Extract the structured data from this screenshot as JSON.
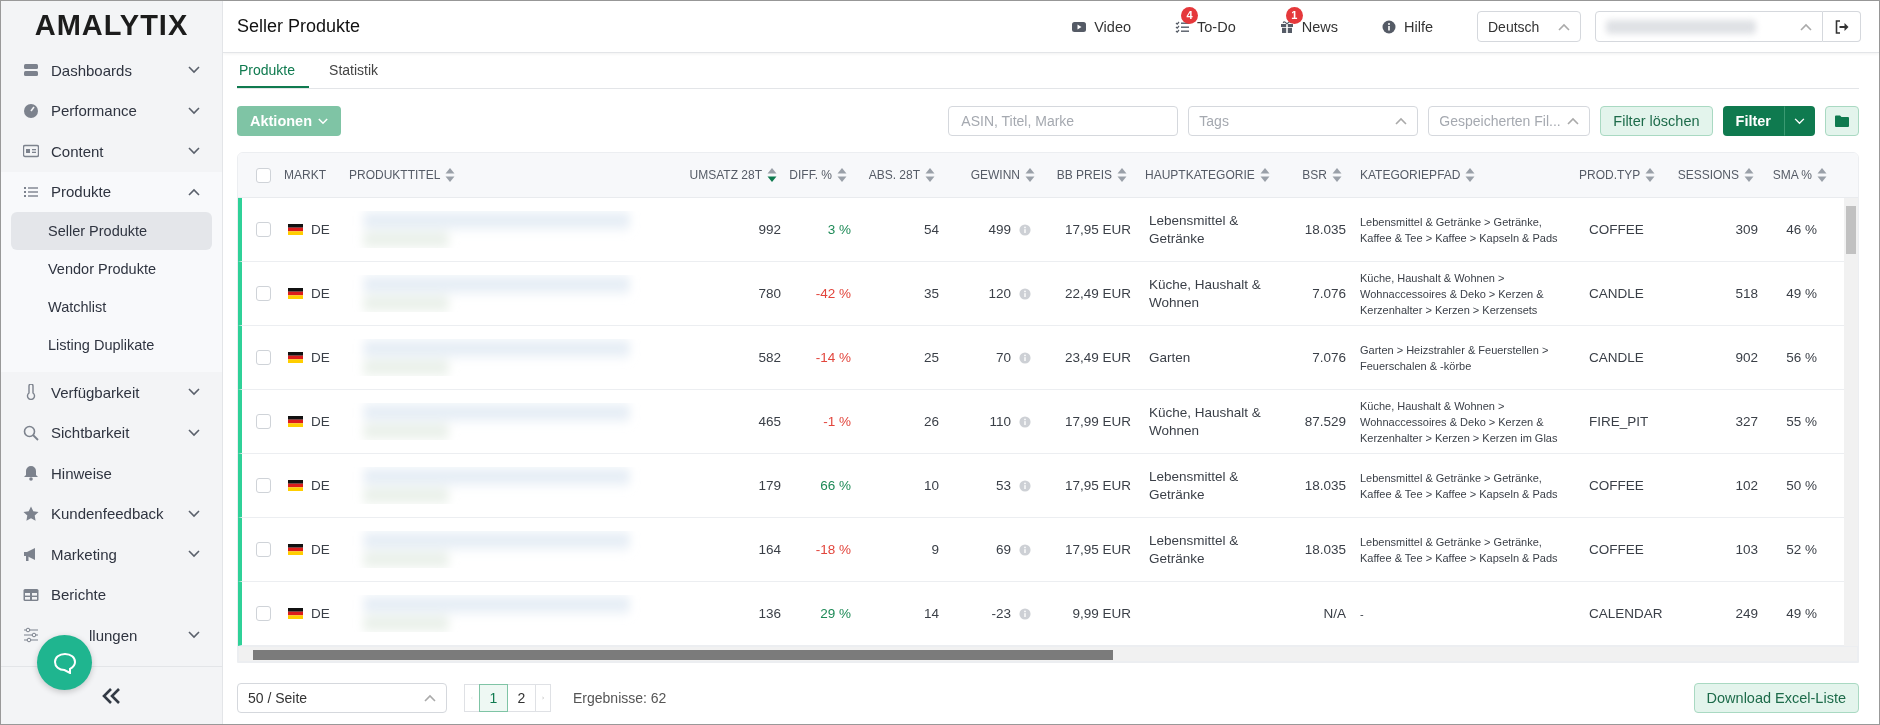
{
  "sidebar": {
    "logo": "AMALYTIX",
    "items": [
      {
        "label": "Dashboards",
        "expanded": false
      },
      {
        "label": "Performance",
        "expanded": false
      },
      {
        "label": "Content",
        "expanded": false
      },
      {
        "label": "Produkte",
        "expanded": true,
        "children": [
          {
            "label": "Seller Produkte",
            "selected": true
          },
          {
            "label": "Vendor Produkte",
            "selected": false
          },
          {
            "label": "Watchlist",
            "selected": false
          },
          {
            "label": "Listing Duplikate",
            "selected": false
          }
        ]
      },
      {
        "label": "Verfügbarkeit",
        "expanded": false
      },
      {
        "label": "Sichtbarkeit",
        "expanded": false
      },
      {
        "label": "Hinweise"
      },
      {
        "label": "Kundenfeedback",
        "expanded": false
      },
      {
        "label": "Marketing",
        "expanded": false
      },
      {
        "label": "Berichte"
      },
      {
        "label": "llungen",
        "expanded": false,
        "covered": true
      }
    ]
  },
  "header": {
    "title": "Seller Produkte",
    "links": [
      {
        "label": "Video"
      },
      {
        "label": "To-Do",
        "badge": "4"
      },
      {
        "label": "News",
        "badge": "1"
      },
      {
        "label": "Hilfe"
      }
    ],
    "language": "Deutsch"
  },
  "tabs": [
    {
      "label": "Produkte",
      "selected": true
    },
    {
      "label": "Statistik",
      "selected": false
    }
  ],
  "toolbar": {
    "actions": "Aktionen",
    "search_placeholder": "ASIN, Titel, Marke",
    "tags_placeholder": "Tags",
    "saved_placeholder": "Gespeicherten Fil...",
    "clear": "Filter löschen",
    "filter": "Filter"
  },
  "table": {
    "columns": [
      {
        "label": "MARKT"
      },
      {
        "label": "PRODUKTTITEL",
        "sorted": false
      },
      {
        "label": "UMSATZ 28T",
        "sorted": true
      },
      {
        "label": "DIFF. %",
        "sorted": false
      },
      {
        "label": "ABS. 28T",
        "sorted": false
      },
      {
        "label": "GEWINN",
        "sorted": false
      },
      {
        "label": "BB PREIS",
        "sorted": false
      },
      {
        "label": "HAUPTKATEGORIE",
        "sorted": false
      },
      {
        "label": "BSR",
        "sorted": false
      },
      {
        "label": "KATEGORIEPFAD",
        "sorted": false
      },
      {
        "label": "PROD.TYP",
        "sorted": false
      },
      {
        "label": "SESSIONS",
        "sorted": false
      },
      {
        "label": "SMA %",
        "sorted": false
      }
    ],
    "select_all_checked": false,
    "rows": [
      {
        "checked": false,
        "market": "DE",
        "umsatz": "992",
        "diff": "3 %",
        "positive": true,
        "abs": "54",
        "gewinn": "499",
        "bb_preis": "17,95 EUR",
        "hauptkategorie": "Lebensmittel & Getränke",
        "bsr": "18.035",
        "kategoriepfad": "Lebensmittel & Getränke > Getränke, Kaffee & Tee > Kaffee > Kapseln & Pads",
        "prod_typ": "COFFEE",
        "sessions": "309",
        "sma": "46 %"
      },
      {
        "checked": false,
        "market": "DE",
        "umsatz": "780",
        "diff": "-42 %",
        "positive": false,
        "abs": "35",
        "gewinn": "120",
        "bb_preis": "22,49 EUR",
        "hauptkategorie": "Küche, Haushalt & Wohnen",
        "bsr": "7.076",
        "kategoriepfad": "Küche, Haushalt & Wohnen > Wohnaccessoires & Deko > Kerzen & Kerzenhalter > Kerzen > Kerzensets",
        "prod_typ": "CANDLE",
        "sessions": "518",
        "sma": "49 %"
      },
      {
        "checked": false,
        "market": "DE",
        "umsatz": "582",
        "diff": "-14 %",
        "positive": false,
        "abs": "25",
        "gewinn": "70",
        "bb_preis": "23,49 EUR",
        "hauptkategorie": "Garten",
        "bsr": "7.076",
        "kategoriepfad": "Garten > Heizstrahler & Feuerstellen > Feuerschalen & -körbe",
        "prod_typ": "CANDLE",
        "sessions": "902",
        "sma": "56 %"
      },
      {
        "checked": false,
        "market": "DE",
        "umsatz": "465",
        "diff": "-1 %",
        "positive": false,
        "abs": "26",
        "gewinn": "110",
        "bb_preis": "17,99 EUR",
        "hauptkategorie": "Küche, Haushalt & Wohnen",
        "bsr": "87.529",
        "kategoriepfad": "Küche, Haushalt & Wohnen > Wohnaccessoires & Deko > Kerzen & Kerzenhalter > Kerzen > Kerzen im Glas",
        "prod_typ": "FIRE_PIT",
        "sessions": "327",
        "sma": "55 %"
      },
      {
        "checked": false,
        "market": "DE",
        "umsatz": "179",
        "diff": "66 %",
        "positive": true,
        "abs": "10",
        "gewinn": "53",
        "bb_preis": "17,95 EUR",
        "hauptkategorie": "Lebensmittel & Getränke",
        "bsr": "18.035",
        "kategoriepfad": "Lebensmittel & Getränke > Getränke, Kaffee & Tee > Kaffee > Kapseln & Pads",
        "prod_typ": "COFFEE",
        "sessions": "102",
        "sma": "50 %"
      },
      {
        "checked": false,
        "market": "DE",
        "umsatz": "164",
        "diff": "-18 %",
        "positive": false,
        "abs": "9",
        "gewinn": "69",
        "bb_preis": "17,95 EUR",
        "hauptkategorie": "Lebensmittel & Getränke",
        "bsr": "18.035",
        "kategoriepfad": "Lebensmittel & Getränke > Getränke, Kaffee & Tee > Kaffee > Kapseln & Pads",
        "prod_typ": "COFFEE",
        "sessions": "103",
        "sma": "52 %"
      },
      {
        "checked": false,
        "market": "DE",
        "umsatz": "136",
        "diff": "29 %",
        "positive": true,
        "abs": "14",
        "gewinn": "-23",
        "bb_preis": "9,99 EUR",
        "bsr": "N/A",
        "kategoriepfad": "-",
        "prod_typ": "CALENDAR",
        "sessions": "249",
        "sma": "49 %"
      }
    ]
  },
  "footer": {
    "page_size": "50 / Seite",
    "pages": [
      {
        "label": "1",
        "selected": true
      },
      {
        "label": "2",
        "selected": false
      }
    ],
    "results": "Ergebnisse: 62",
    "download": "Download Excel-Liste"
  }
}
